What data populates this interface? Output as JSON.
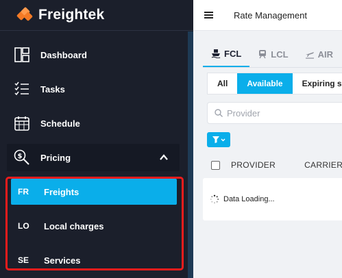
{
  "brand": {
    "name": "Freightek",
    "logo_color": "#f47a25"
  },
  "sidebar": {
    "items": [
      {
        "label": "Dashboard",
        "icon": "dashboard-icon"
      },
      {
        "label": "Tasks",
        "icon": "tasks-icon"
      },
      {
        "label": "Schedule",
        "icon": "calendar-icon"
      },
      {
        "label": "Pricing",
        "icon": "pricing-icon",
        "expanded": true
      }
    ],
    "pricing_subitems": [
      {
        "abbr": "FR",
        "label": "Freights",
        "active": true
      },
      {
        "abbr": "LO",
        "label": "Local charges",
        "active": false
      },
      {
        "abbr": "SE",
        "label": "Services",
        "active": false
      }
    ]
  },
  "header": {
    "title": "Rate Management"
  },
  "tabs": [
    {
      "label": "FCL",
      "icon": "ship-icon",
      "active": true
    },
    {
      "label": "LCL",
      "icon": "train-icon",
      "active": false
    },
    {
      "label": "AIR",
      "icon": "plane-icon",
      "active": false
    }
  ],
  "filters": [
    {
      "label": "All",
      "active": false
    },
    {
      "label": "Available",
      "active": true
    },
    {
      "label": "Expiring so",
      "active": false
    }
  ],
  "search": {
    "placeholder": "Provider",
    "value": ""
  },
  "table": {
    "columns": [
      "PROVIDER",
      "CARRIER"
    ]
  },
  "loading": {
    "text": "Data Loading..."
  },
  "colors": {
    "accent": "#0aaeea",
    "sidebar_bg": "#1b1f2b",
    "highlight": "#ee1c1c"
  }
}
